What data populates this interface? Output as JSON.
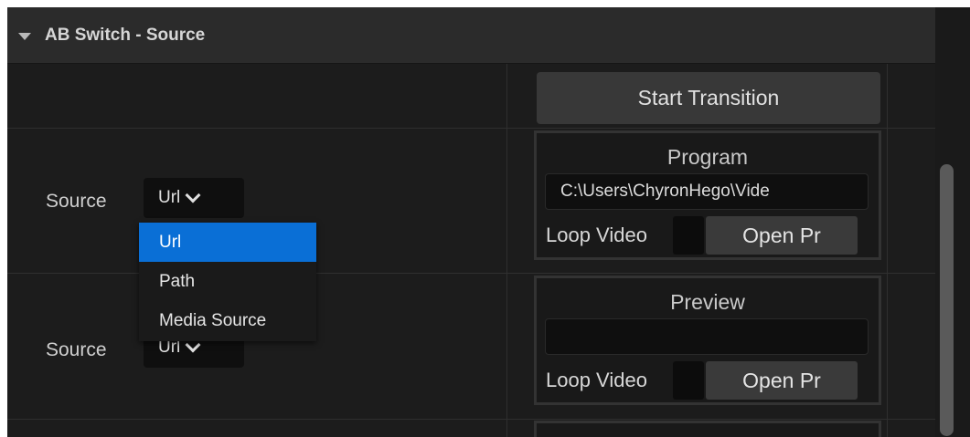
{
  "section": {
    "title": "AB Switch - Source"
  },
  "toolbar": {
    "start_transition_label": "Start Transition"
  },
  "rows": [
    {
      "source_label": "Source",
      "source_value": "Url"
    },
    {
      "source_label": "Source",
      "source_value": "Url"
    }
  ],
  "dropdown": {
    "options": [
      {
        "label": "Url",
        "selected": true
      },
      {
        "label": "Path",
        "selected": false
      },
      {
        "label": "Media Source",
        "selected": false
      }
    ]
  },
  "panels": {
    "program": {
      "title": "Program",
      "path_value": "C:\\Users\\ChyronHego\\Vide",
      "loop_label": "Loop Video",
      "open_label": "Open Pr"
    },
    "preview": {
      "title": "Preview",
      "path_value": "",
      "loop_label": "Loop Video",
      "open_label": "Open Pr"
    }
  },
  "colors": {
    "background": "#1c1c1c",
    "header": "#2b2b2b",
    "selected": "#0a6fd6",
    "button": "#383838"
  }
}
